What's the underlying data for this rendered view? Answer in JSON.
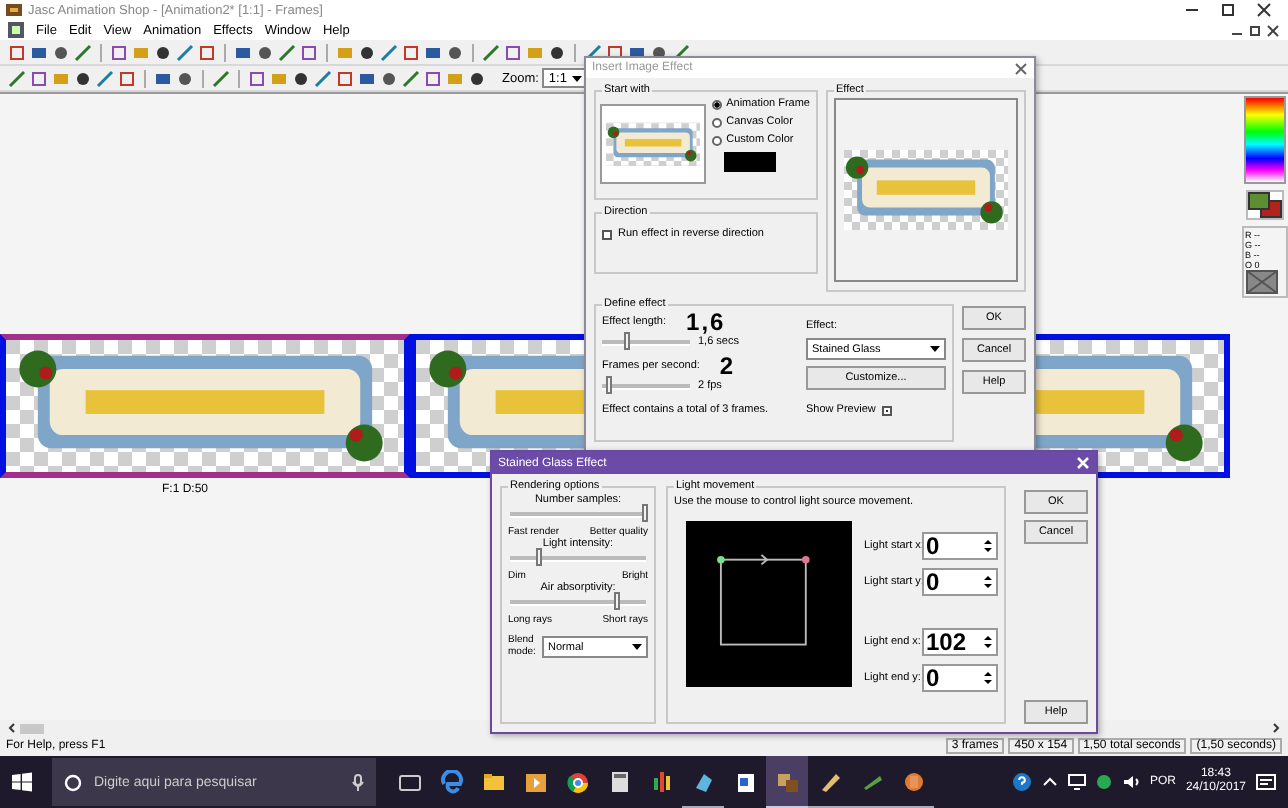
{
  "window": {
    "title": "Jasc Animation Shop - [Animation2* [1:1] - Frames]"
  },
  "menu": [
    "File",
    "Edit",
    "View",
    "Animation",
    "Effects",
    "Window",
    "Help"
  ],
  "zoom": {
    "label": "Zoom:",
    "value": "1:1"
  },
  "frames": [
    {
      "caption": "F:1   D:50",
      "selected": true
    },
    {
      "selected": false
    },
    {
      "selected": false
    }
  ],
  "palette": {
    "readouts": [
      "R --",
      "G --",
      "B --",
      "O 0"
    ]
  },
  "insert_effect": {
    "title": "Insert Image Effect",
    "start_with": {
      "label": "Start with",
      "options": [
        {
          "label": "Animation Frame",
          "selected": true
        },
        {
          "label": "Canvas Color",
          "selected": false
        },
        {
          "label": "Custom Color",
          "selected": false
        }
      ]
    },
    "direction": {
      "label": "Direction",
      "checkbox": {
        "label": "Run effect in reverse direction",
        "checked": false
      }
    },
    "effect_preview": {
      "label": "Effect"
    },
    "define": {
      "label": "Define effect",
      "sliders": [
        {
          "label": "Effect length:",
          "annotation": "1,6",
          "level": 0.3,
          "reading": "1,6 secs"
        },
        {
          "label": "Frames per second:",
          "annotation": "2",
          "level": 0.1,
          "reading": "2 fps"
        }
      ],
      "summary": "Effect contains a total of 3 frames.",
      "effect_label": "Effect:",
      "effect_value": "Stained Glass",
      "customize": "Customize...",
      "show_preview": {
        "label": "Show Preview",
        "checked": true
      }
    },
    "buttons": [
      "OK",
      "Cancel",
      "Help"
    ]
  },
  "stained_glass": {
    "title": "Stained Glass Effect",
    "rendering": {
      "label": "Rendering options",
      "sliders": [
        {
          "label": "Number samples:",
          "level": 1.0,
          "low": "Fast render",
          "high": "Better quality"
        },
        {
          "label": "Light intensity:",
          "level": 0.22,
          "low": "Dim",
          "high": "Bright"
        },
        {
          "label": "Air absorptivity:",
          "level": 0.8,
          "low": "Long rays",
          "high": "Short rays"
        }
      ],
      "blend_label": "Blend mode:",
      "blend_value": "Normal"
    },
    "light": {
      "label": "Light movement",
      "hint": "Use the mouse to control light source movement.",
      "fields": [
        {
          "label": "Light start x:",
          "value": "0"
        },
        {
          "label": "Light start y:",
          "value": "0"
        },
        {
          "label": "Light end x:",
          "value": "102"
        },
        {
          "label": "Light end y:",
          "value": "0"
        }
      ]
    },
    "buttons": [
      "OK",
      "Cancel",
      "Help"
    ]
  },
  "status_bar": {
    "help": "For Help, press F1",
    "panes": [
      "3 frames",
      "450 x 154",
      "1,50 total seconds",
      "(1,50 seconds)"
    ]
  },
  "taskbar": {
    "search_placeholder": "Digite aqui para pesquisar",
    "language": "POR",
    "time": "18:43",
    "date": "24/10/2017"
  }
}
